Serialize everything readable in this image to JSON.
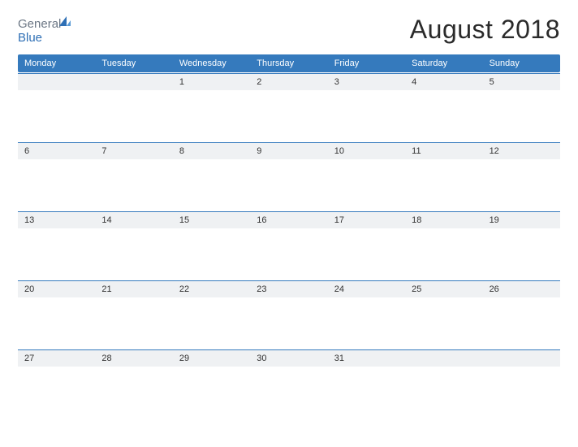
{
  "logo": {
    "text1": "General",
    "text2": "Blue"
  },
  "title": "August 2018",
  "dayHeaders": [
    "Monday",
    "Tuesday",
    "Wednesday",
    "Thursday",
    "Friday",
    "Saturday",
    "Sunday"
  ],
  "weeks": [
    [
      "",
      "",
      "1",
      "2",
      "3",
      "4",
      "5"
    ],
    [
      "6",
      "7",
      "8",
      "9",
      "10",
      "11",
      "12"
    ],
    [
      "13",
      "14",
      "15",
      "16",
      "17",
      "18",
      "19"
    ],
    [
      "20",
      "21",
      "22",
      "23",
      "24",
      "25",
      "26"
    ],
    [
      "27",
      "28",
      "29",
      "30",
      "31",
      "",
      ""
    ]
  ]
}
